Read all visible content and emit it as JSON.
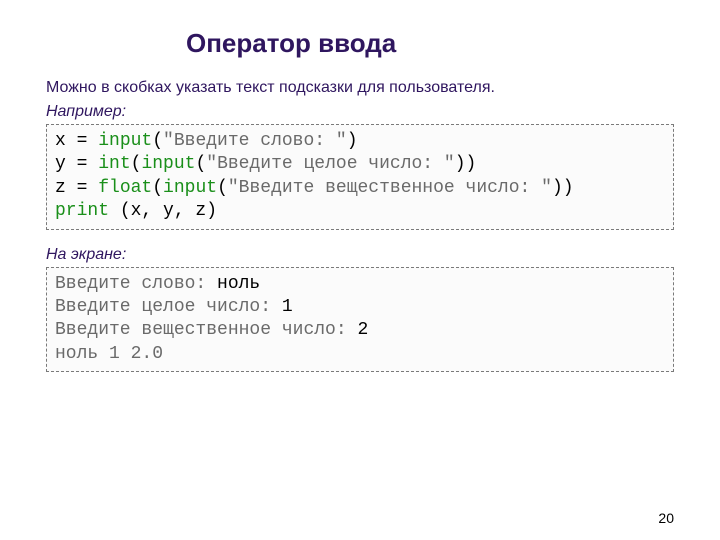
{
  "title": "Оператор ввода",
  "intro": "Можно в скобках указать текст подсказки для пользователя.",
  "example_label": "Например:",
  "output_label": "На экране:",
  "code": {
    "l1": {
      "a": "x = ",
      "fn": "input",
      "p1": "(",
      "s": "\"Введите слово: \"",
      "p2": ")"
    },
    "l2": {
      "a": "y = ",
      "fn1": "int",
      "p1": "(",
      "fn2": "input",
      "p2": "(",
      "s": "\"Введите целое число: \"",
      "p3": "))"
    },
    "l3": {
      "a": "z = ",
      "fn1": "float",
      "p1": "(",
      "fn2": "input",
      "p2": "(",
      "s": "\"Введите вещественное число: \"",
      "p3": "))"
    },
    "l4": {
      "fn": "print",
      "rest": " (x, y, z)"
    }
  },
  "out": {
    "l1": {
      "p": "Введите слово: ",
      "v": "ноль"
    },
    "l2": {
      "p": "Введите целое число: ",
      "v": "1"
    },
    "l3": {
      "p": "Введите вещественное число: ",
      "v": "2"
    },
    "l4": {
      "r": "ноль 1 2.0"
    }
  },
  "page_number": "20"
}
